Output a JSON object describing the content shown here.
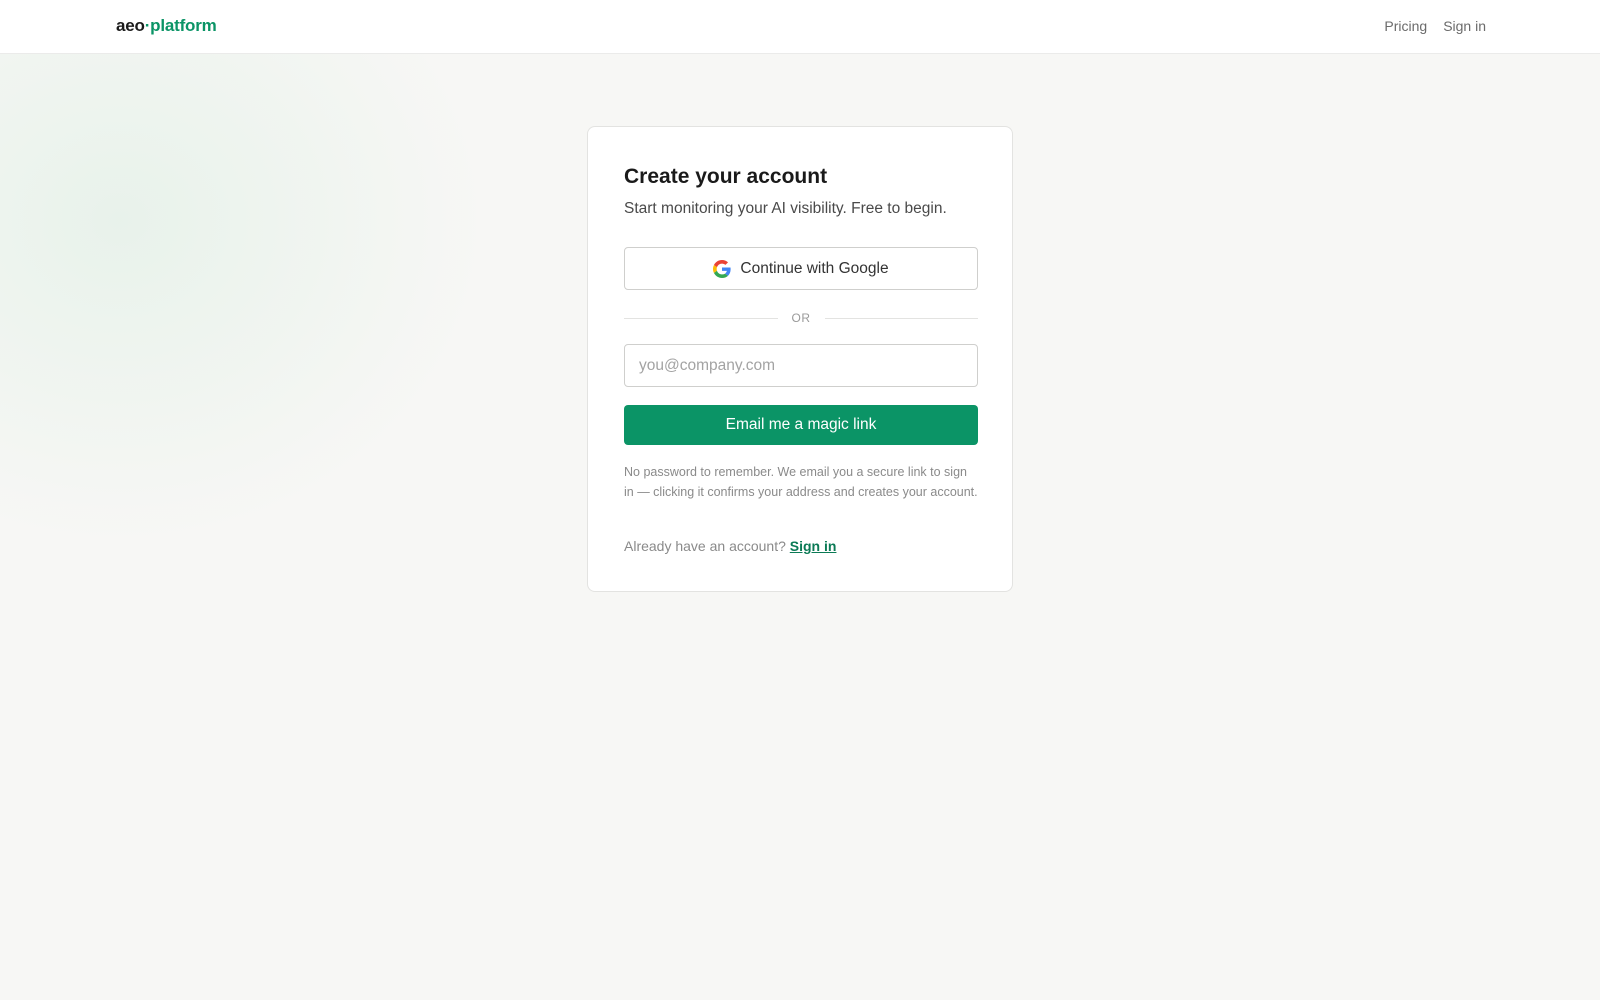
{
  "header": {
    "logo_part1": "aeo",
    "logo_dot": "·",
    "logo_part2": "platform",
    "nav": {
      "pricing_label": "Pricing",
      "signin_label": "Sign in"
    }
  },
  "signup": {
    "title": "Create your account",
    "subtitle": "Start monitoring your AI visibility. Free to begin.",
    "google_button_label": "Continue with Google",
    "google_icon": "google-icon",
    "divider_text": "OR",
    "email_value": "",
    "email_placeholder": "you@company.com",
    "magic_link_button_label": "Email me a magic link",
    "help_text": "No password to remember. We email you a secure link to sign in — clicking it confirms your address and creates your account.",
    "existing_account_prompt": "Already have an account?",
    "signin_link_label": "Sign in"
  },
  "colors": {
    "accent": "#0b9466",
    "link": "#0b7a55",
    "page_background": "#f7f7f5",
    "card_background": "#ffffff"
  }
}
